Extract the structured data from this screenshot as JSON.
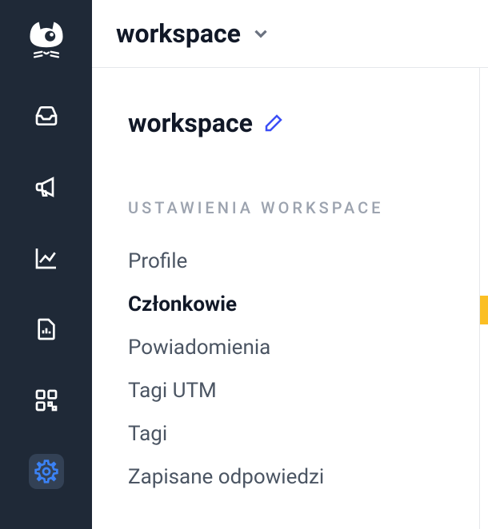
{
  "header": {
    "workspace_dropdown_label": "workspace"
  },
  "workspace": {
    "name": "workspace"
  },
  "settings": {
    "section_label": "USTAWIENIA WORKSPACE",
    "items": [
      {
        "label": "Profile",
        "active": false
      },
      {
        "label": "Członkowie",
        "active": true
      },
      {
        "label": "Powiadomienia",
        "active": false
      },
      {
        "label": "Tagi UTM",
        "active": false
      },
      {
        "label": "Tagi",
        "active": false
      },
      {
        "label": "Zapisane odpowiedzi",
        "active": false
      }
    ]
  },
  "sidebar": {
    "items": [
      {
        "name": "inbox",
        "active": false
      },
      {
        "name": "announcements",
        "active": false
      },
      {
        "name": "analytics",
        "active": false
      },
      {
        "name": "reports",
        "active": false
      },
      {
        "name": "integrations",
        "active": false
      },
      {
        "name": "settings",
        "active": true
      }
    ]
  }
}
